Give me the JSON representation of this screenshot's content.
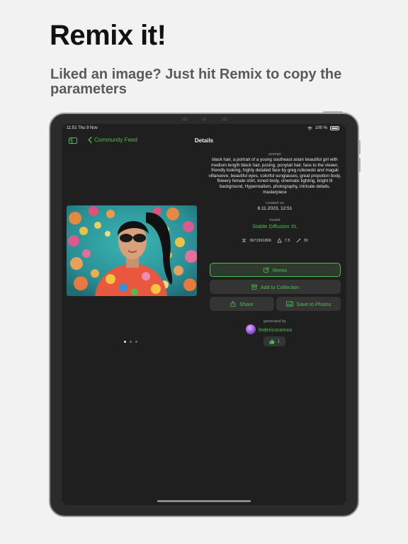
{
  "promo": {
    "headline": "Remix it!",
    "subhead": "Liked an image? Just hit Remix to copy the parameters"
  },
  "status_bar": {
    "time": "11:51  Thu 9 Nov",
    "battery": "100 %"
  },
  "nav": {
    "back_label": "Community Feed",
    "title": "Details"
  },
  "details": {
    "prompt_label": "prompt",
    "prompt": "black hair, a portrait of a young southeast asian beautiful girl with medium length black hair, posing, ponytail hair, face to the viewer, friendly looking, highly detailed face by greg rutkowski and magali villanueve, beautiful eyes, colorful sunglasses, great propotion body, flowery female shirt, toned body, cinematic lighting, bright lit background, Hyperrealism, photography, intricate details, masterpiece",
    "created_label": "created on",
    "created": "8.11.2023, 12:51",
    "model_label": "model",
    "model": "Stable Diffusion XL",
    "seed": "3671591806",
    "guidance": "7.5",
    "steps": "30"
  },
  "actions": {
    "remix": "Remix",
    "add_collection": "Add to Collection",
    "share": "Share",
    "save_photos": "Save to Photos"
  },
  "author": {
    "label": "generated by",
    "username": "federicoramos",
    "likes": "1"
  },
  "carousel": {
    "pages": 3,
    "active": 1
  },
  "colors": {
    "accent": "#4cc04f",
    "background": "#1f1f1f",
    "button": "#343434"
  }
}
